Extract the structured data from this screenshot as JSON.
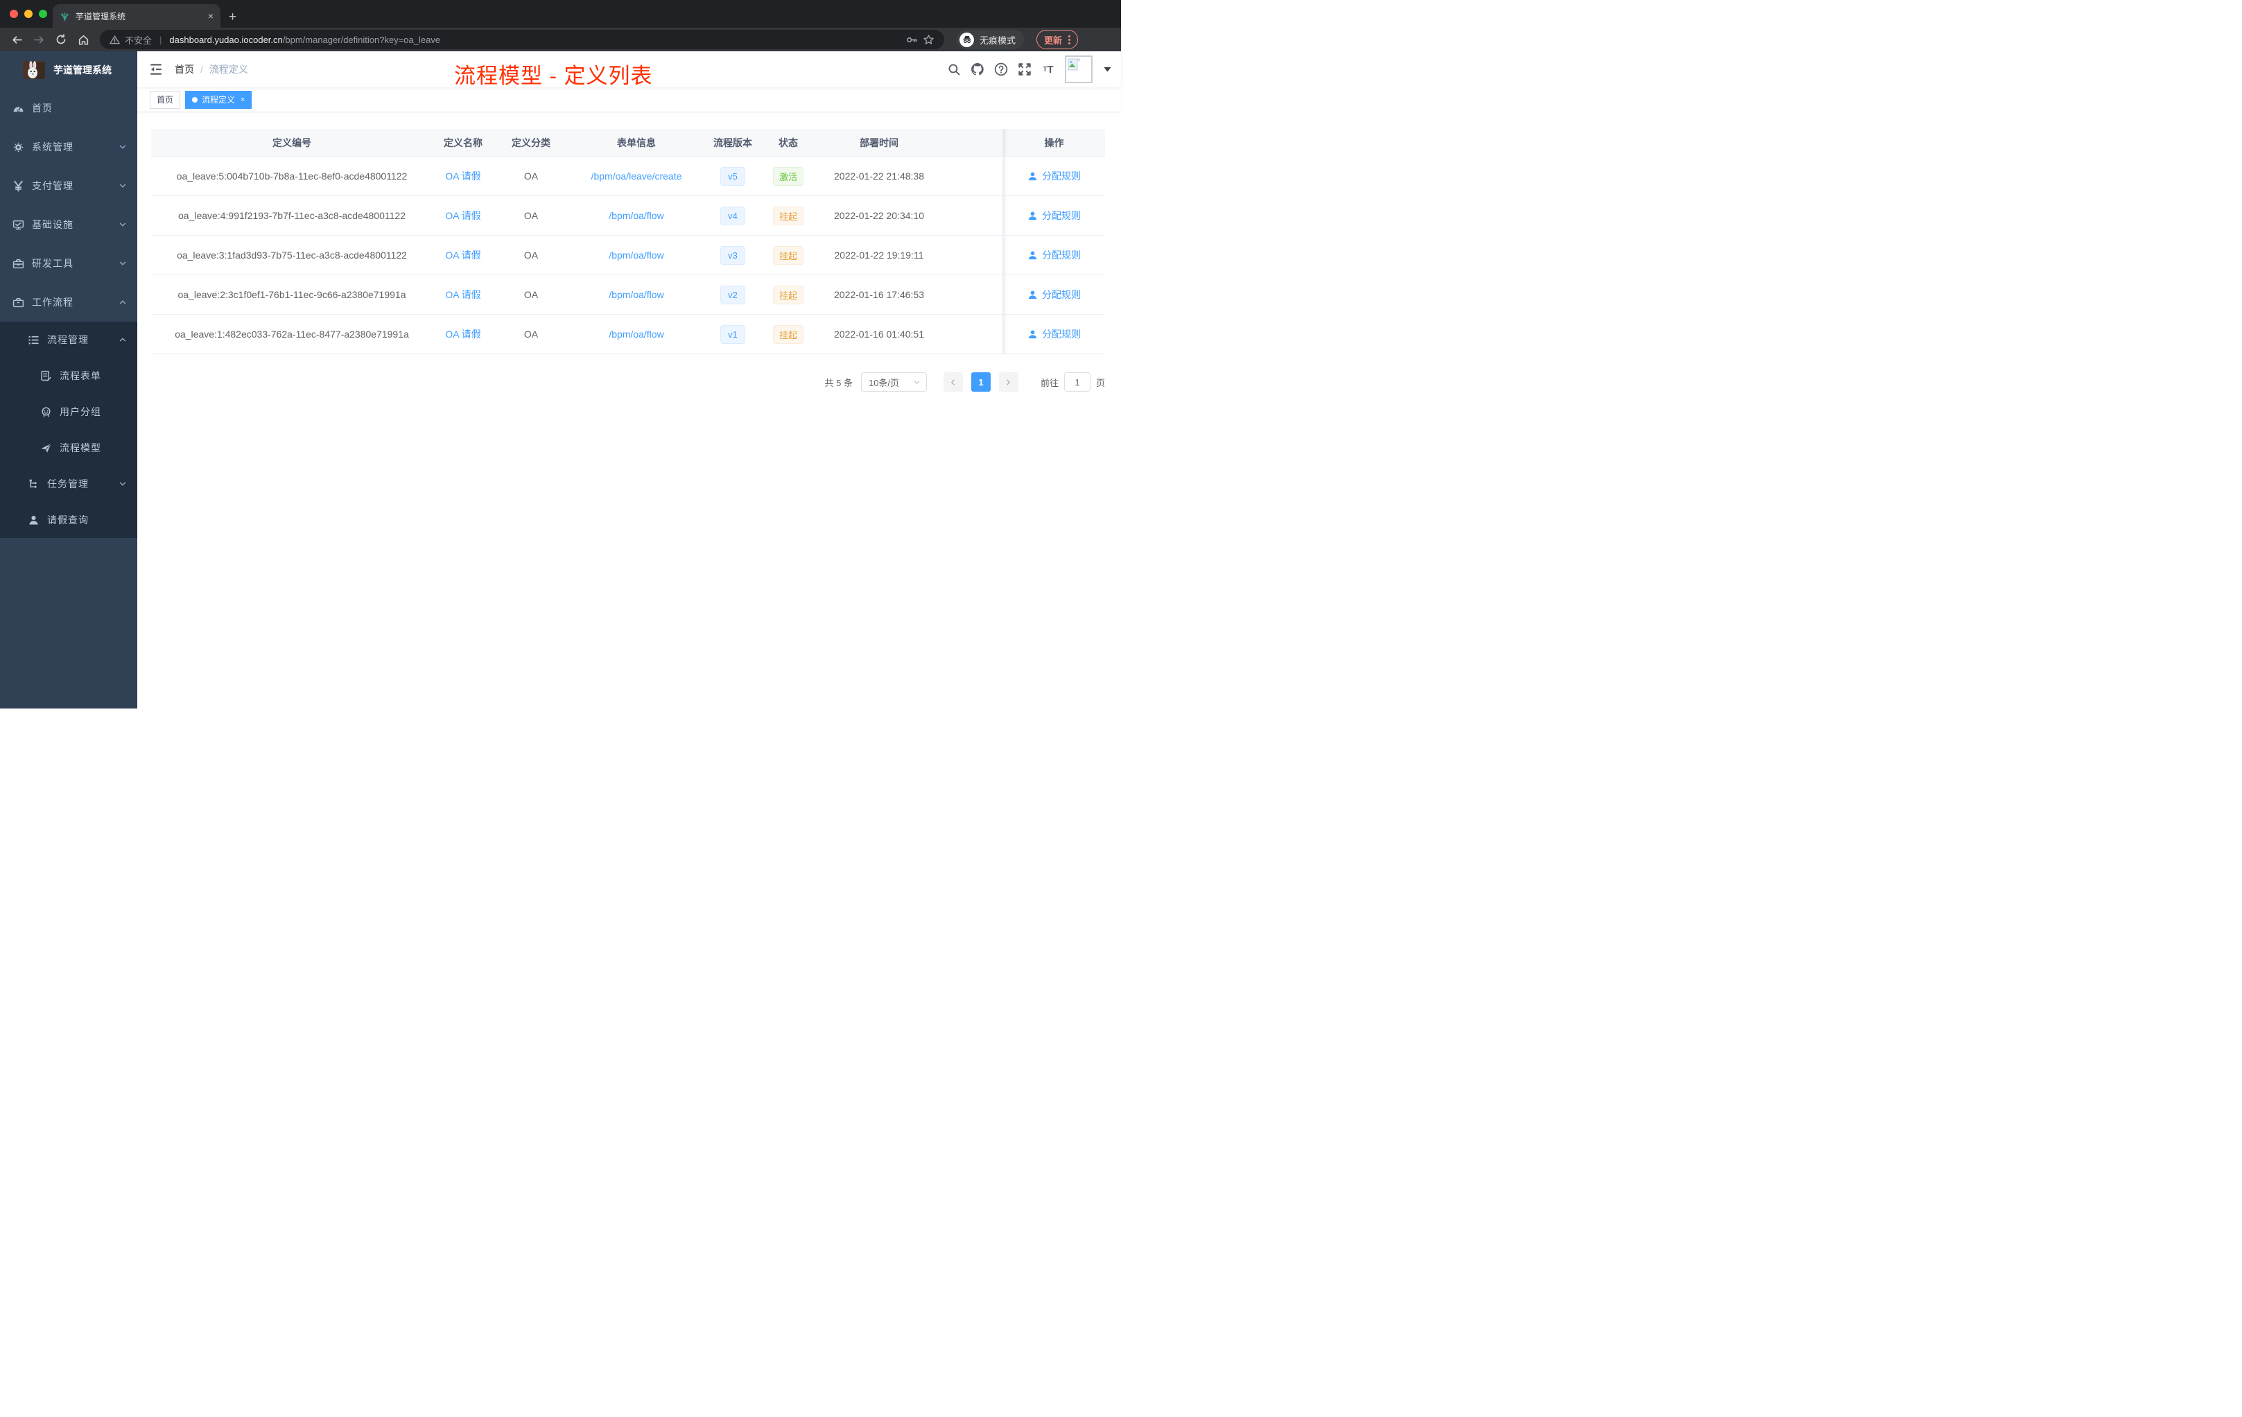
{
  "browser": {
    "tab_title": "芋道管理系统",
    "new_tab_glyph": "+",
    "close_glyph": "×",
    "security_label": "不安全",
    "url_host": "dashboard.yudao.iocoder.cn",
    "url_path": "/bpm/manager/definition?key=oa_leave",
    "incognito_label": "无痕模式",
    "update_label": "更新"
  },
  "sidebar": {
    "app_title": "芋道管理系统",
    "items": [
      {
        "label": "首页",
        "icon": "dashboard-icon"
      },
      {
        "label": "系统管理",
        "icon": "gear-icon",
        "state": "collapsed"
      },
      {
        "label": "支付管理",
        "icon": "yen-icon",
        "state": "collapsed"
      },
      {
        "label": "基础设施",
        "icon": "monitor-icon",
        "state": "collapsed"
      },
      {
        "label": "研发工具",
        "icon": "toolbox-icon",
        "state": "collapsed"
      },
      {
        "label": "工作流程",
        "icon": "briefcase-icon",
        "state": "expanded",
        "children": [
          {
            "label": "流程管理",
            "icon": "list-icon",
            "state": "expanded",
            "children": [
              {
                "label": "流程表单",
                "icon": "form-icon"
              },
              {
                "label": "用户分组",
                "icon": "robot-icon"
              },
              {
                "label": "流程模型",
                "icon": "send-icon"
              }
            ]
          },
          {
            "label": "任务管理",
            "icon": "tree-icon",
            "state": "collapsed"
          },
          {
            "label": "请假查询",
            "icon": "user-icon"
          }
        ]
      }
    ]
  },
  "header": {
    "breadcrumb": [
      "首页",
      "流程定义"
    ],
    "breadcrumb_separator": "/",
    "annotation_title": "流程模型 - 定义列表",
    "action_icons": [
      "search-icon",
      "github-icon",
      "help-icon",
      "fullscreen-icon",
      "font-size-icon",
      "avatar",
      "caret-down-icon"
    ]
  },
  "tags": [
    {
      "label": "首页",
      "active": false
    },
    {
      "label": "流程定义",
      "active": true,
      "close_glyph": "×"
    }
  ],
  "table": {
    "columns": [
      "定义编号",
      "定义名称",
      "定义分类",
      "表单信息",
      "流程版本",
      "状态",
      "部署时间",
      "操作"
    ],
    "rows": [
      {
        "id": "oa_leave:5:004b710b-7b8a-11ec-8ef0-acde48001122",
        "name": "OA 请假",
        "category": "OA",
        "form": "/bpm/oa/leave/create",
        "version": "v5",
        "status": "激活",
        "status_class": "tag-success",
        "deploy_time": "2022-01-22 21:48:38",
        "action": "分配规则"
      },
      {
        "id": "oa_leave:4:991f2193-7b7f-11ec-a3c8-acde48001122",
        "name": "OA 请假",
        "category": "OA",
        "form": "/bpm/oa/flow",
        "version": "v4",
        "status": "挂起",
        "status_class": "tag-warning",
        "deploy_time": "2022-01-22 20:34:10",
        "action": "分配规则"
      },
      {
        "id": "oa_leave:3:1fad3d93-7b75-11ec-a3c8-acde48001122",
        "name": "OA 请假",
        "category": "OA",
        "form": "/bpm/oa/flow",
        "version": "v3",
        "status": "挂起",
        "status_class": "tag-warning",
        "deploy_time": "2022-01-22 19:19:11",
        "action": "分配规则"
      },
      {
        "id": "oa_leave:2:3c1f0ef1-76b1-11ec-9c66-a2380e71991a",
        "name": "OA 请假",
        "category": "OA",
        "form": "/bpm/oa/flow",
        "version": "v2",
        "status": "挂起",
        "status_class": "tag-warning",
        "deploy_time": "2022-01-16 17:46:53",
        "action": "分配规则"
      },
      {
        "id": "oa_leave:1:482ec033-762a-11ec-8477-a2380e71991a",
        "name": "OA 请假",
        "category": "OA",
        "form": "/bpm/oa/flow",
        "version": "v1",
        "status": "挂起",
        "status_class": "tag-warning",
        "deploy_time": "2022-01-16 01:40:51",
        "action": "分配规则"
      }
    ]
  },
  "pagination": {
    "total": "共 5 条",
    "page_size": "10条/页",
    "current_page": "1",
    "jump_prefix": "前往",
    "jump_value": "1",
    "jump_suffix": "页"
  },
  "colors": {
    "accent": "#409eff",
    "success": "#67c23a",
    "warning": "#e6a23c",
    "annotation_red": "#ff2f00",
    "sidebar_bg": "#304156",
    "submenu_bg": "#1f2d3d",
    "chrome_frame": "#1f2124",
    "chrome_toolbar": "#35363a",
    "update_red": "#f28b82"
  }
}
